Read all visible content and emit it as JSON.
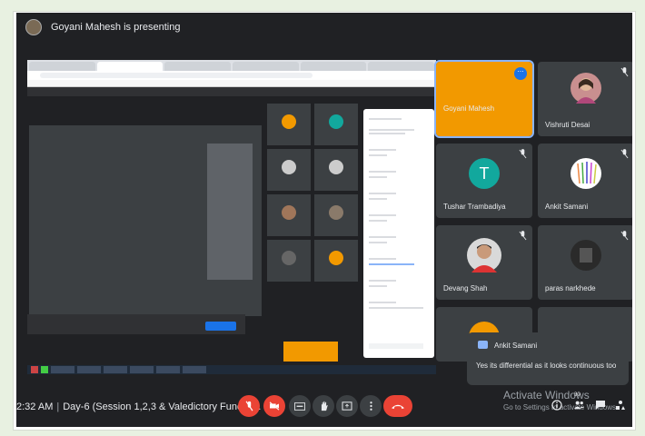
{
  "header": {
    "presenter_text": "Goyani Mahesh is presenting"
  },
  "participants": [
    {
      "name": "Goyani Mahesh",
      "tile": "orange"
    },
    {
      "name": "Vishruti Desai",
      "tile": "photo"
    },
    {
      "name": "Tushar Trambadiya",
      "tile": "letter",
      "letter": "T"
    },
    {
      "name": "Ankit Samani",
      "tile": "photo"
    },
    {
      "name": "Devang Shah",
      "tile": "photo"
    },
    {
      "name": "paras narkhede",
      "tile": "photo"
    }
  ],
  "chat_popup": {
    "sender": "Ankit Samani",
    "message": "Yes its differential as it looks continuous too"
  },
  "bottom_bar": {
    "time": "2:32 AM",
    "meeting_title": "Day-6 (Session 1,2,3 & Valedictory Functio..."
  },
  "people_count": "30",
  "watermark": {
    "line1": "Activate Windows",
    "line2": "Go to Settings to activate Windows."
  },
  "colors": {
    "orange_tile": "#f29900",
    "end_call": "#ea4335",
    "tile_bg": "#3c4043",
    "meet_bg": "#202124",
    "avatar_teal": "#12a89d"
  }
}
